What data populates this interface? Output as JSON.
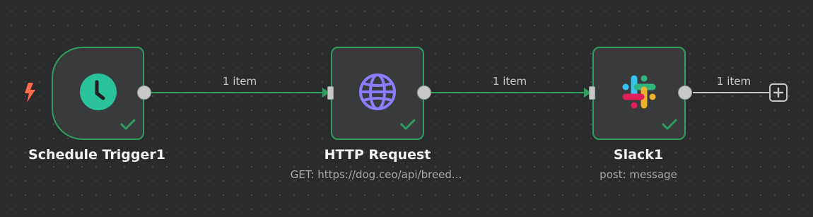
{
  "workflow": {
    "nodes": [
      {
        "name": "Schedule Trigger1",
        "subtitle": "",
        "icon": "clock-icon",
        "status": "success",
        "icon_color": "#29c29b"
      },
      {
        "name": "HTTP Request",
        "subtitle": "GET: https://dog.ceo/api/breed...",
        "icon": "globe-icon",
        "status": "success",
        "icon_color": "#8b7dff"
      },
      {
        "name": "Slack1",
        "subtitle": "post: message",
        "icon": "slack-icon",
        "status": "success"
      }
    ],
    "connections": [
      {
        "label": "1 item"
      },
      {
        "label": "1 item"
      },
      {
        "label": "1 item"
      }
    ],
    "trigger_icon": "lightning-icon",
    "add_node_icon": "plus-icon"
  },
  "colors": {
    "success": "#2f9e5e",
    "edge": "#2f9e5e",
    "trigger_bolt": "#ff6b4a",
    "node_bg": "#393a3c"
  }
}
